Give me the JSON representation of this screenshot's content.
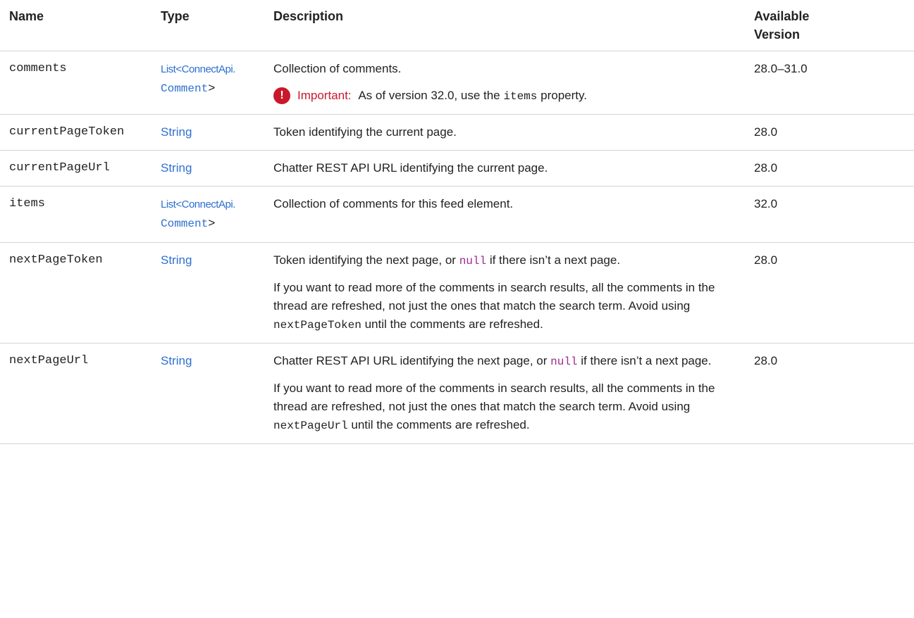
{
  "headers": {
    "name": "Name",
    "type": "Type",
    "description": "Description",
    "version_line1": "Available",
    "version_line2": "Version"
  },
  "rows": [
    {
      "name": "comments",
      "type_prefix": "List<",
      "type_link1": "ConnectApi.",
      "type_link2": "Comment",
      "type_suffix": ">",
      "desc": "Collection of comments.",
      "important_label": "Important:",
      "important_pre": "As of version 32.0, use the",
      "important_code": "items",
      "important_post": "property.",
      "version": "28.0–31.0"
    },
    {
      "name": "currentPageToken",
      "type": "String",
      "desc": "Token identifying the current page.",
      "version": "28.0"
    },
    {
      "name": "currentPageUrl",
      "type": "String",
      "desc": "Chatter REST API URL identifying the current page.",
      "version": "28.0"
    },
    {
      "name": "items",
      "type_prefix": "List<",
      "type_link1": "ConnectApi.",
      "type_link2": "Comment",
      "type_suffix": ">",
      "desc": "Collection of comments for this feed element.",
      "version": "32.0"
    },
    {
      "name": "nextPageToken",
      "type": "String",
      "desc_pre": "Token identifying the next page, or",
      "desc_code": "null",
      "desc_post": "if there isn’t a next page.",
      "note_pre": "If you want to read more of the comments in search results, all the comments in the thread are refreshed, not just the ones that match the search term. Avoid using",
      "note_code": "nextPageToken",
      "note_post": "until the comments are refreshed.",
      "version": "28.0"
    },
    {
      "name": "nextPageUrl",
      "type": "String",
      "desc_pre": "Chatter REST API URL identifying the next page, or",
      "desc_code": "null",
      "desc_post": "if there isn’t a next page.",
      "note_pre": "If you want to read more of the comments in search results, all the comments in the thread are refreshed, not just the ones that match the search term. Avoid using",
      "note_code": "nextPageUrl",
      "note_post": "until the comments are refreshed.",
      "version": "28.0"
    }
  ],
  "icons": {
    "important": "exclamation-circle-icon"
  },
  "colors": {
    "link": "#2d6fd1",
    "important": "#c9182b",
    "code": "#9e2a8e"
  }
}
